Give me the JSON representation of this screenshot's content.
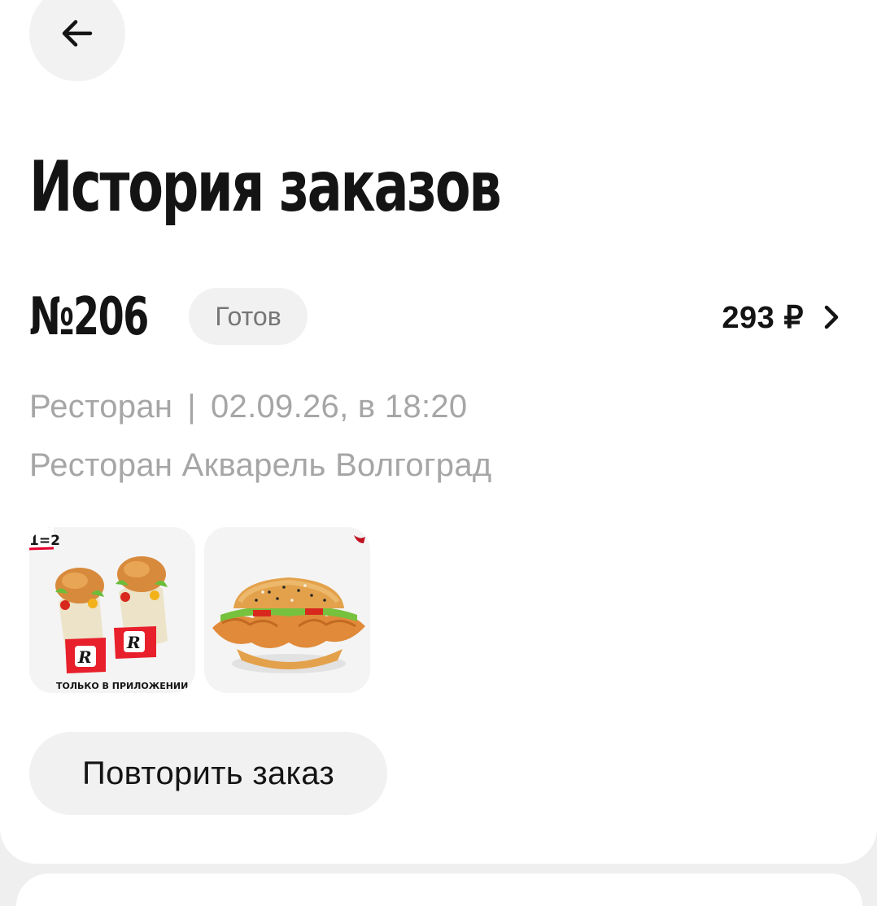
{
  "header": {
    "back_icon": "arrow-left-icon",
    "title": "История заказов"
  },
  "order": {
    "number": "№206",
    "status": "Готов",
    "price": "293 ₽",
    "chevron_icon": "chevron-right-icon",
    "channel": "Ресторан",
    "separator": "|",
    "datetime": "02.09.26, в 18:20",
    "restaurant": "Ресторан Акварель Волгоград",
    "items": [
      {
        "name": "twister-duo-image",
        "badge": "ТОЛЬКО В ПРИЛОЖЕНИИ",
        "corner": "1=2"
      },
      {
        "name": "chicken-burger-image"
      }
    ],
    "repeat_label": "Повторить заказ"
  },
  "colors": {
    "background": "#ffffff",
    "text_primary": "#141414",
    "text_secondary": "#a6a6a6",
    "pill": "#f1f1f1",
    "brand_red": "#e4002b"
  }
}
